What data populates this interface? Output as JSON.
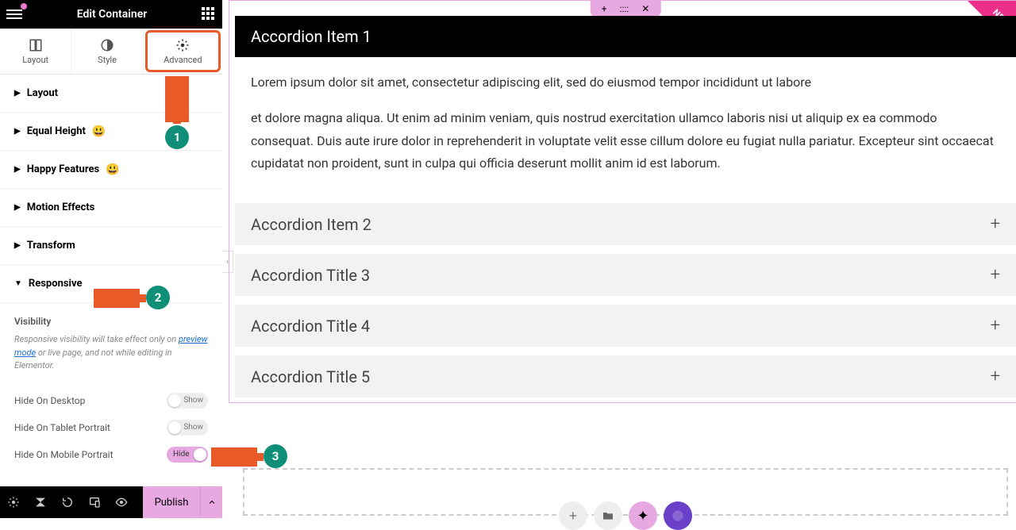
{
  "panel": {
    "title": "Edit Container",
    "tabs": {
      "layout": "Layout",
      "style": "Style",
      "advanced": "Advanced"
    },
    "sections": {
      "layout": "Layout",
      "equal_height": "Equal Height",
      "happy_features": "Happy Features",
      "motion_effects": "Motion Effects",
      "transform": "Transform",
      "responsive": "Responsive"
    },
    "visibility": {
      "title": "Visibility",
      "help": "Responsive visibility will take effect only on ",
      "help_link": "preview mode",
      "help_tail": " or live page, and not while editing in Elementor.",
      "rows": {
        "desktop": {
          "label": "Hide On Desktop",
          "text": "Show",
          "on": false
        },
        "tablet": {
          "label": "Hide On Tablet Portrait",
          "text": "Show",
          "on": false
        },
        "mobile": {
          "label": "Hide On Mobile Portrait",
          "text": "Hide",
          "on": true
        }
      }
    },
    "publish": "Publish"
  },
  "canvas": {
    "editbar": {
      "add": "+",
      "drag": "::::",
      "close": "✕"
    },
    "new_ribbon": "NEW",
    "accordion": [
      {
        "title": "Accordion Item 1",
        "open": true,
        "body": [
          "Lorem ipsum dolor sit amet, consectetur adipiscing elit, sed do eiusmod tempor incididunt ut labore",
          "et dolore magna aliqua. Ut enim ad minim veniam, quis nostrud exercitation ullamco laboris nisi ut aliquip ex ea commodo consequat. Duis aute irure dolor in reprehenderit in voluptate velit esse cillum dolore eu fugiat nulla pariatur. Excepteur sint occaecat cupidatat non proident, sunt in culpa qui officia deserunt mollit anim id est laborum."
        ]
      },
      {
        "title": "Accordion Item 2",
        "open": false
      },
      {
        "title": "Accordion Title 3",
        "open": false
      },
      {
        "title": "Accordion Title 4",
        "open": false
      },
      {
        "title": "Accordion Title 5",
        "open": false
      }
    ]
  },
  "annotations": {
    "b1": "1",
    "b2": "2",
    "b3": "3"
  }
}
